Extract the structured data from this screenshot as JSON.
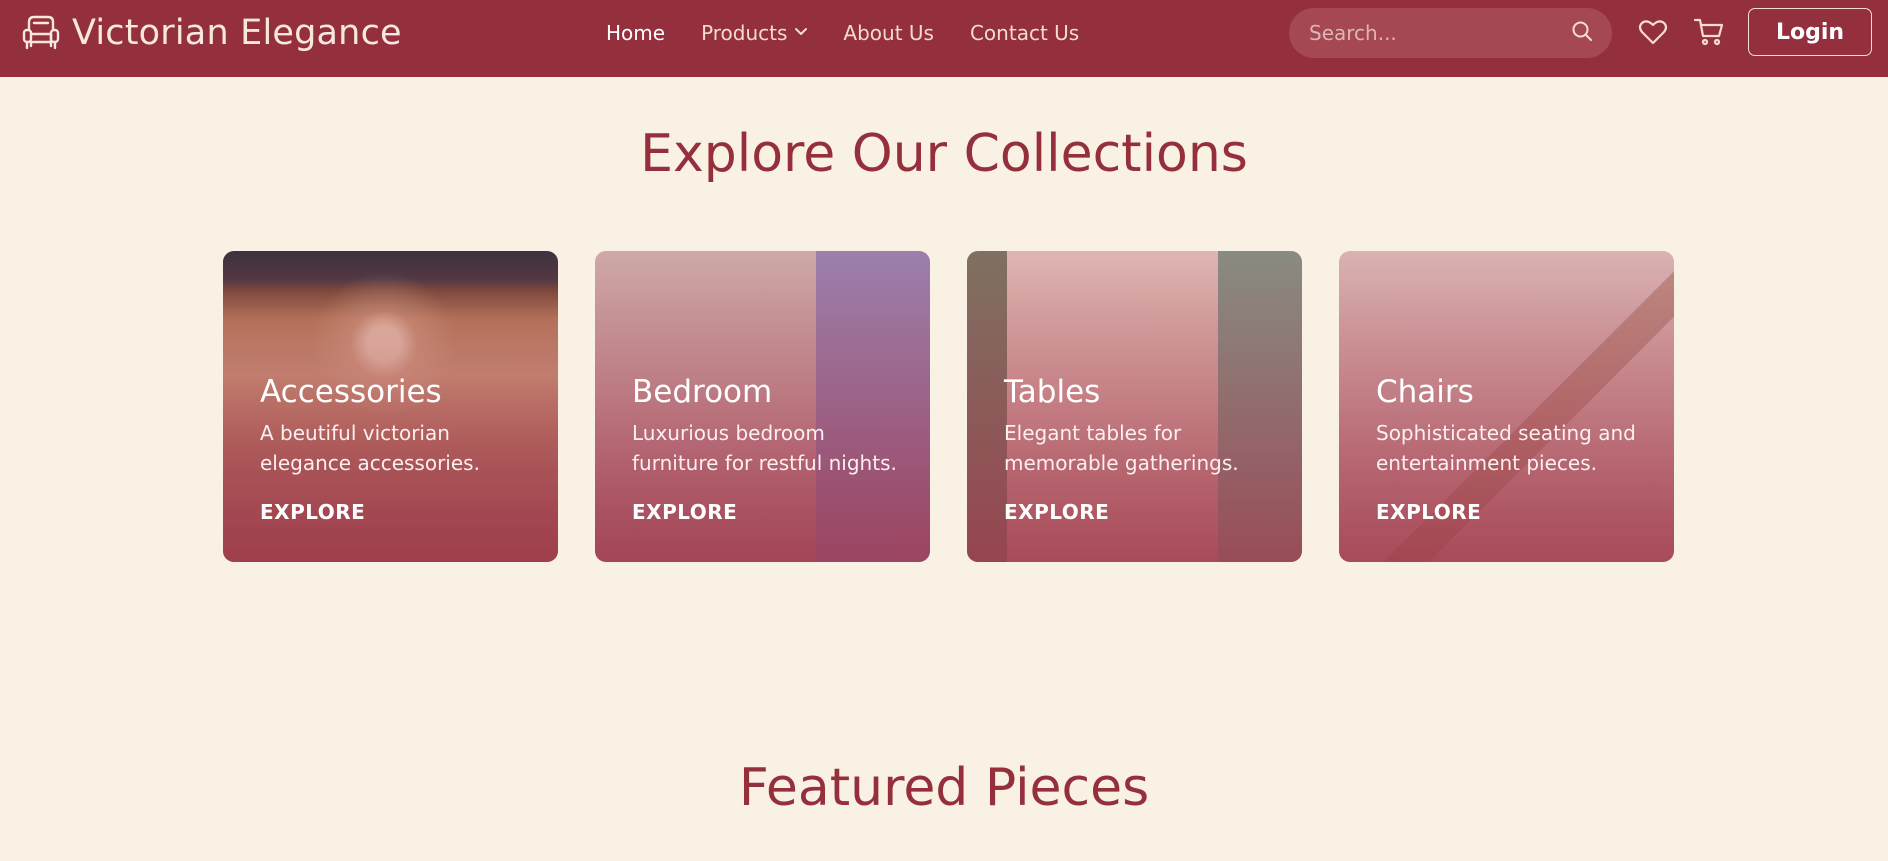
{
  "brand": {
    "name": "Victorian Elegance",
    "logo_icon": "armchair-icon"
  },
  "nav": {
    "items": [
      {
        "label": "Home",
        "active": true
      },
      {
        "label": "Products",
        "has_dropdown": true
      },
      {
        "label": "About Us"
      },
      {
        "label": "Contact Us"
      }
    ]
  },
  "search": {
    "placeholder": "Search...",
    "value": "",
    "icon": "search-icon"
  },
  "actions": {
    "wishlist_icon": "heart-icon",
    "cart_icon": "cart-icon",
    "login_label": "Login"
  },
  "collections": {
    "title": "Explore Our Collections",
    "cards": [
      {
        "title": "Accessories",
        "description": "A beutiful victorian elegance accessories.",
        "cta": "EXPLORE"
      },
      {
        "title": "Bedroom",
        "description": "Luxurious bedroom furniture for restful nights.",
        "cta": "EXPLORE"
      },
      {
        "title": "Tables",
        "description": "Elegant tables for memorable gatherings.",
        "cta": "EXPLORE"
      },
      {
        "title": "Chairs",
        "description": "Sophisticated seating and entertainment pieces.",
        "cta": "EXPLORE"
      }
    ]
  },
  "featured": {
    "title": "Featured Pieces"
  },
  "colors": {
    "primary": "#942f3d",
    "background": "#f9f1e4",
    "accent_text": "#952f3c",
    "nav_text": "#f2dad6"
  }
}
